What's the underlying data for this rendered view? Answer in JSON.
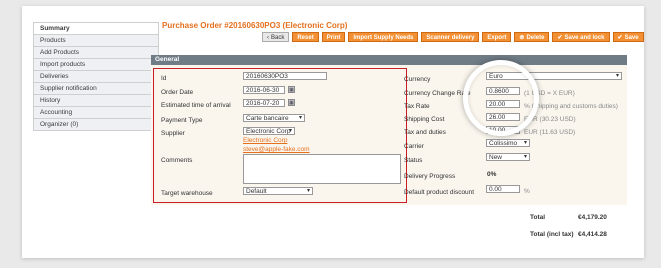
{
  "sidebar": {
    "items": [
      {
        "label": "Summary"
      },
      {
        "label": "Products"
      },
      {
        "label": "Add Products"
      },
      {
        "label": "Import products"
      },
      {
        "label": "Deliveries"
      },
      {
        "label": "Supplier notification"
      },
      {
        "label": "History"
      },
      {
        "label": "Accounting"
      },
      {
        "label": "Organizer (0)"
      }
    ]
  },
  "title": "Purchase Order #20160630PO3 (Electronic Corp)",
  "toolbar": {
    "back": "Back",
    "reset": "Reset",
    "print": "Print",
    "import": "Import Supply Needs",
    "scanner": "Scanner delivery",
    "export": "Export",
    "delete": "Delete",
    "save_lock": "Save and lock",
    "save": "Save"
  },
  "section": "General",
  "left": {
    "id_label": "Id",
    "id_value": "20160630PO3",
    "order_date_label": "Order Date",
    "order_date_value": "2016-06-30",
    "eta_label": "Estimated time of arrival",
    "eta_value": "2016-07-20",
    "payment_label": "Payment Type",
    "payment_value": "Carte bancaire",
    "supplier_label": "Supplier",
    "supplier_value": "Electronic Corp",
    "supplier_link": "Electronic Corp",
    "supplier_email": "steve@apple-fake.com",
    "comments_label": "Comments",
    "warehouse_label": "Target warehouse",
    "warehouse_value": "Default"
  },
  "right": {
    "currency_label": "Currency",
    "currency_value": "Euro",
    "rate_label": "Currency Change Rate",
    "rate_value": "0.8600",
    "rate_note": "(1 USD = X EUR)",
    "tax_label": "Tax Rate",
    "tax_value": "20.00",
    "tax_note": "% (shipping and customs duties)",
    "ship_label": "Shipping Cost",
    "ship_value": "26.00",
    "ship_note": "EUR (30.23 USD)",
    "duties_label": "Tax and duties",
    "duties_value": "10.00",
    "duties_note": "EUR (11.63 USD)",
    "carrier_label": "Carrier",
    "carrier_value": "Colissimo",
    "status_label": "Status",
    "status_value": "New",
    "progress_label": "Delivery Progress",
    "progress_value": "0%",
    "discount_label": "Default product discount",
    "discount_value": "0.00",
    "discount_unit": "%"
  },
  "totals": {
    "total_label": "Total",
    "total_value": "€4,179.20",
    "incl_label": "Total (incl tax)",
    "incl_value": "€4,414.28"
  }
}
